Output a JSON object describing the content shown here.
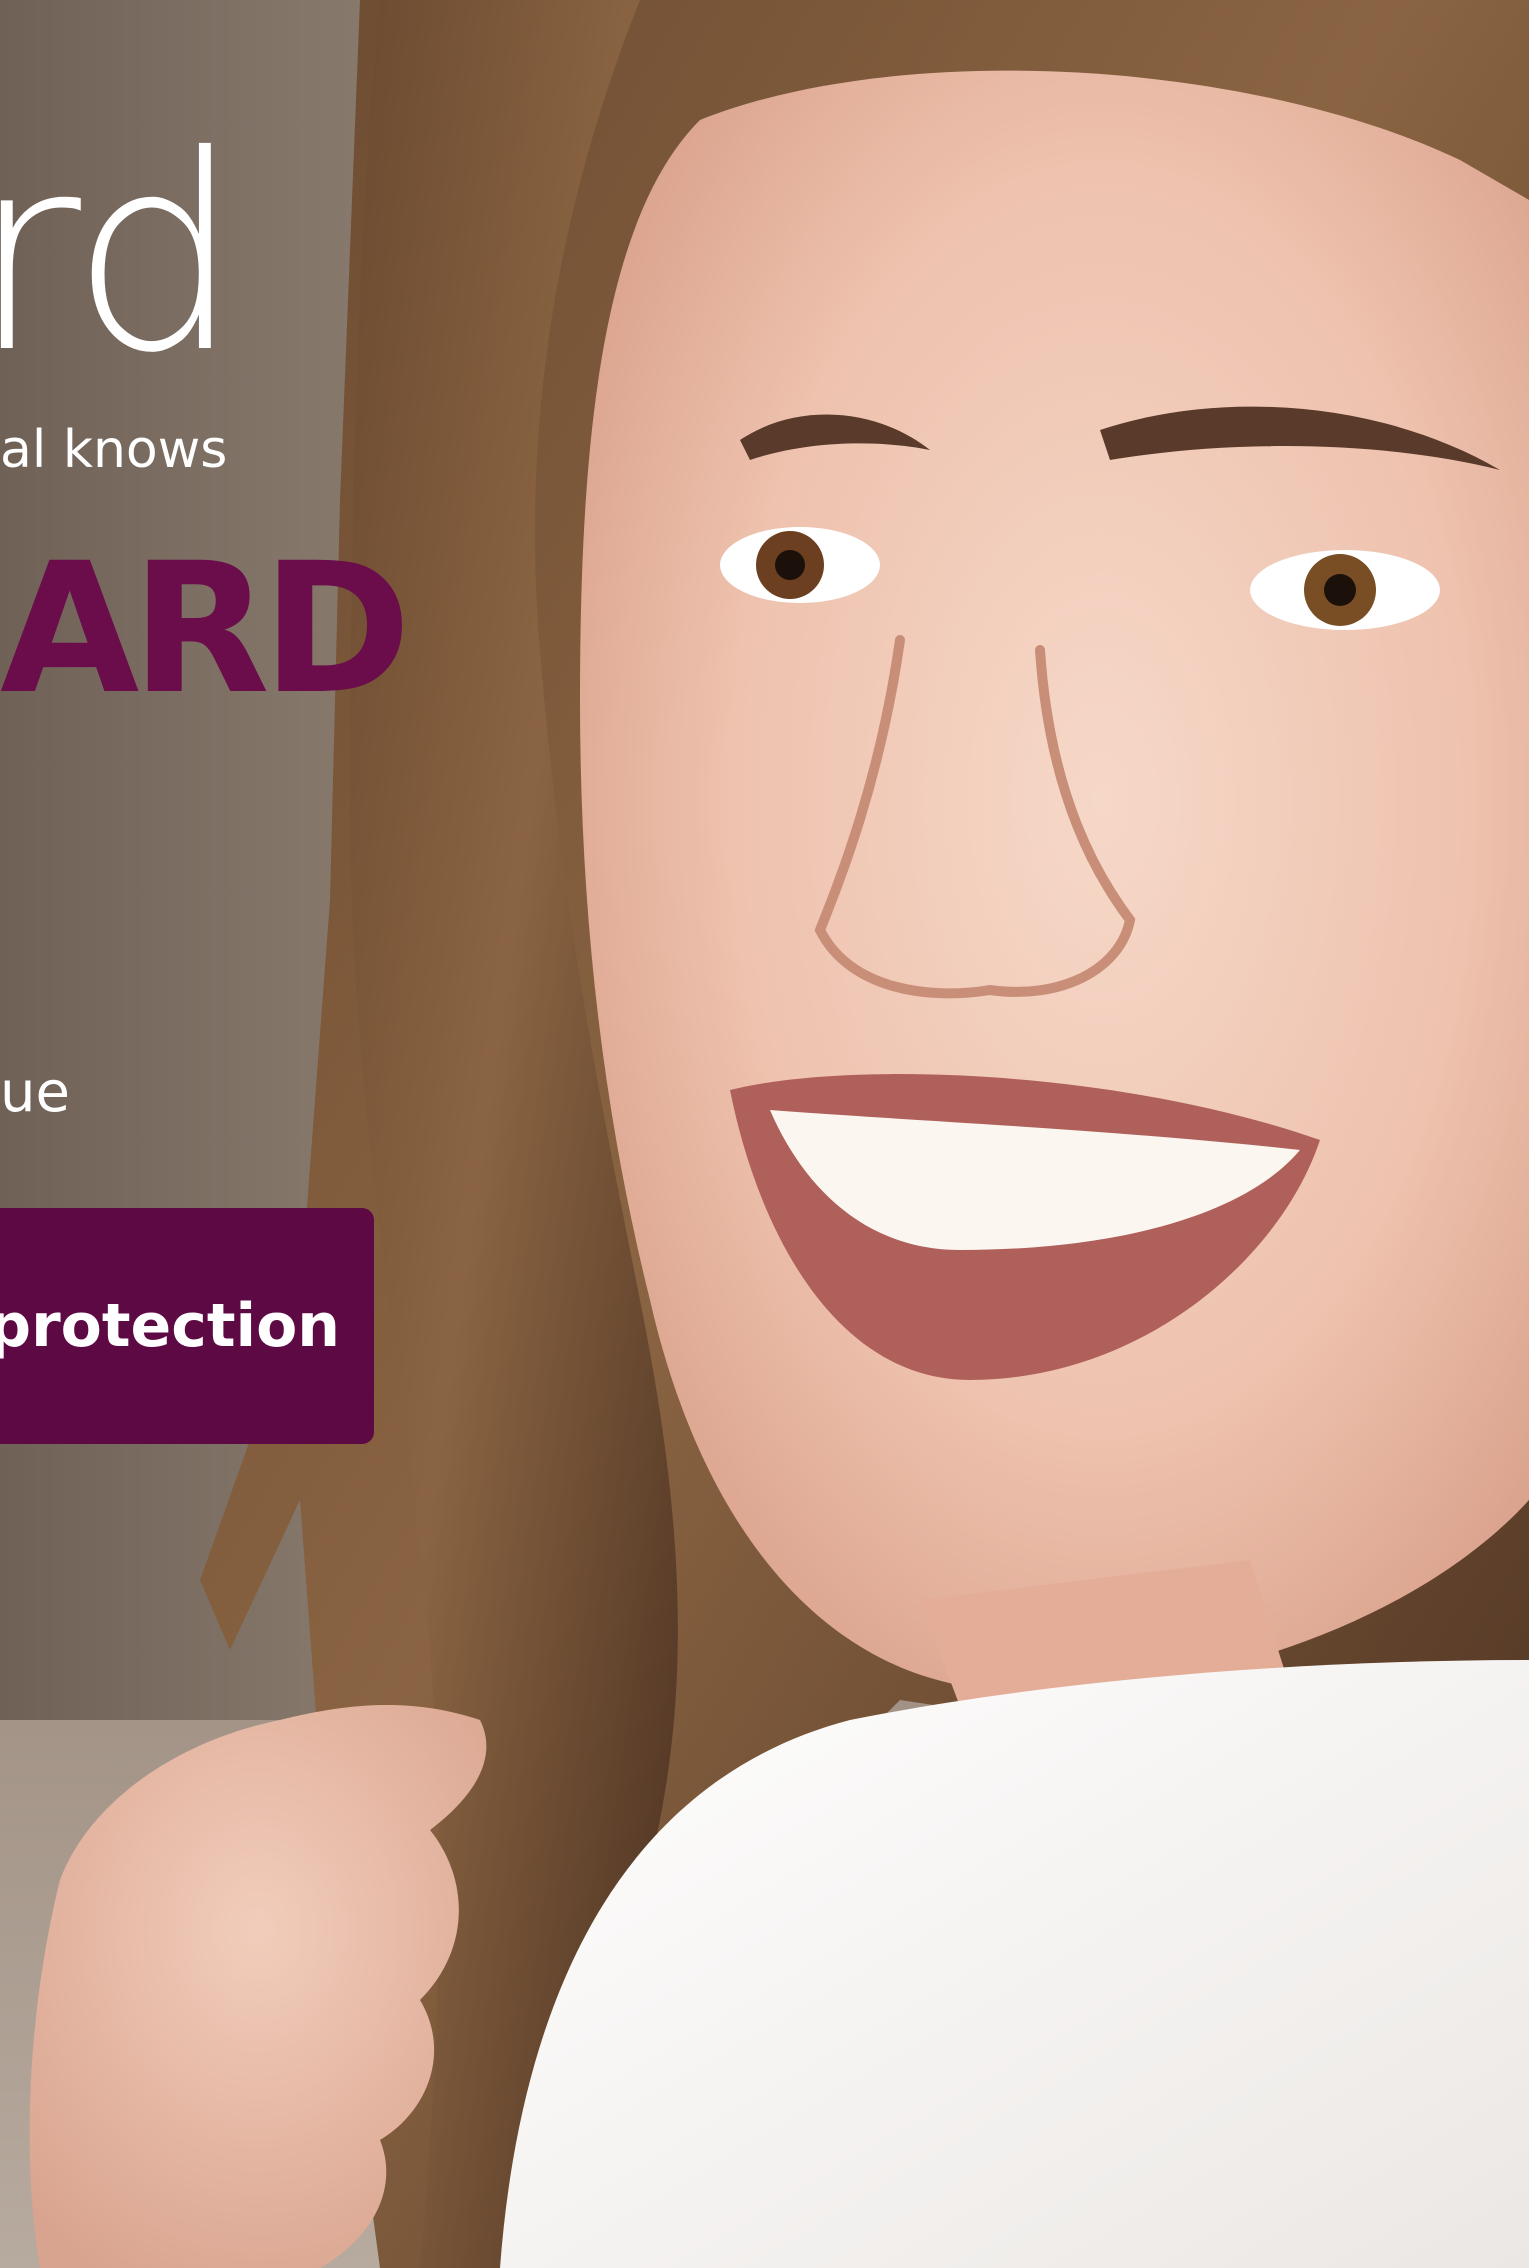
{
  "hero": {
    "brand_partial": "rd",
    "tagline_partial": "al knows",
    "product_partial": "ARD",
    "body_partial": "ue",
    "cta_label": "e protection"
  },
  "colors": {
    "brand_purple": "#6a0d4a",
    "button_purple": "#5d0a44",
    "text_white": "#ffffff",
    "background": "#8c7d70"
  }
}
